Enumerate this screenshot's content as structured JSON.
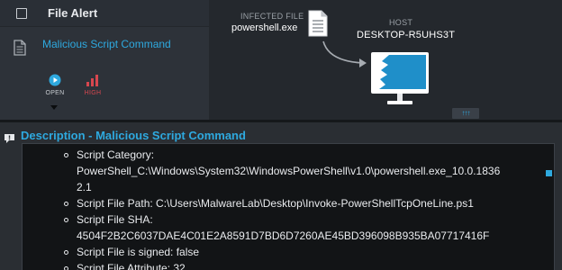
{
  "alert_panel": {
    "title": "File Alert",
    "alert_name": "Malicious Script Command",
    "status_open": "OPEN",
    "status_high": "HIGH"
  },
  "graph": {
    "infected_file_label": "INFECTED FILE",
    "infected_file_value": "powershell.exe",
    "host_label": "HOST",
    "host_value": "DESKTOP-R5UHS3T",
    "expand_label": "↑↑↑"
  },
  "description": {
    "title": "Description - Malicious Script Command",
    "items": [
      {
        "text": "Script Category:"
      },
      {
        "text": "PowerShell_C:\\Windows\\System32\\WindowsPowerShell\\v1.0\\powershell.exe_10.0.1836"
      },
      {
        "text": "2.1"
      },
      {
        "text": "Script File Path: C:\\Users\\MalwareLab\\Desktop\\Invoke-PowerShellTcpOneLine.ps1"
      },
      {
        "text": "Script File SHA:"
      },
      {
        "text": "4504F2B2C6037DAE4C01E2A8591D7BD6D7260AE45BD396098B935BA07717416F"
      },
      {
        "text": "Script File is signed: false"
      },
      {
        "text": "Script File Attribute: 32"
      }
    ]
  },
  "colors": {
    "accent": "#2ea9df",
    "severity_high": "#d7474f"
  }
}
